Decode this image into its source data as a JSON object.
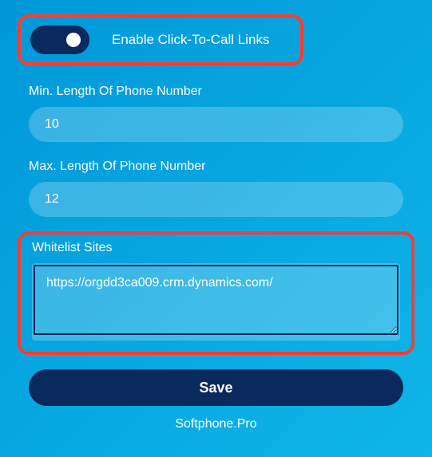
{
  "toggle": {
    "label": "Enable Click-To-Call Links",
    "on": true
  },
  "min_length": {
    "label": "Min. Length Of Phone Number",
    "value": "10"
  },
  "max_length": {
    "label": "Max. Length Of Phone Number",
    "value": "12"
  },
  "whitelist": {
    "label": "Whitelist Sites",
    "value": "https://orgdd3ca009.crm.dynamics.com/"
  },
  "save_label": "Save",
  "footer": "Softphone.Pro",
  "colors": {
    "accent_dark": "#0a2a5e",
    "highlight": "#ff3b2f"
  }
}
